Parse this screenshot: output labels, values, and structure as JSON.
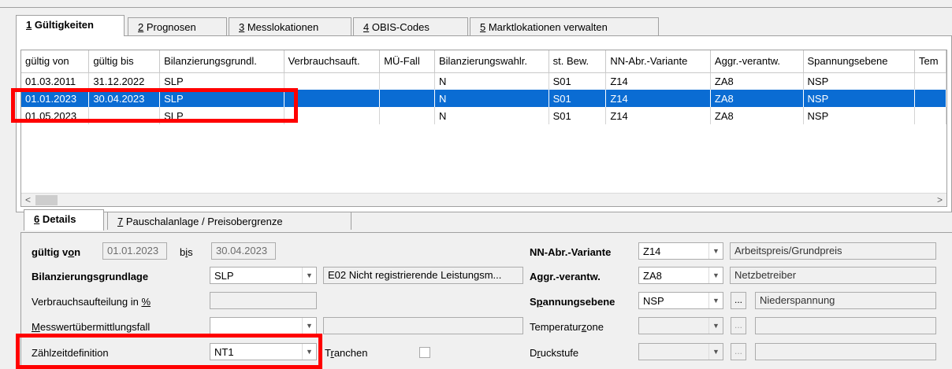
{
  "tabs_top": [
    {
      "key": "1",
      "rest": " Gültigkeiten",
      "active": true
    },
    {
      "key": "2",
      "rest": " Prognosen",
      "active": false
    },
    {
      "key": "3",
      "rest": " Messlokationen",
      "active": false
    },
    {
      "key": "4",
      "rest": " OBIS-Codes",
      "active": false
    },
    {
      "key": "5",
      "rest": " Marktlokationen verwalten",
      "active": false
    }
  ],
  "grid": {
    "columns": [
      "gültig von",
      "gültig bis",
      "Bilanzierungsgrundl.",
      "Verbrauchsauft.",
      "MÜ-Fall",
      "Bilanzierungswahlr.",
      "st. Bew.",
      "NN-Abr.-Variante",
      "Aggr.-verantw.",
      "Spannungsebene",
      "Tem"
    ],
    "rows": [
      [
        "01.03.2011",
        "31.12.2022",
        "SLP",
        "",
        "",
        "N",
        "S01",
        "Z14",
        "ZA8",
        "NSP",
        ""
      ],
      [
        "01.01.2023",
        "30.04.2023",
        "SLP",
        "",
        "",
        "N",
        "S01",
        "Z14",
        "ZA8",
        "NSP",
        ""
      ],
      [
        "01.05.2023",
        "",
        "SLP",
        "",
        "",
        "N",
        "S01",
        "Z14",
        "ZA8",
        "NSP",
        ""
      ]
    ],
    "selected_row": 1
  },
  "scroll": {
    "left_arrow": "<",
    "right_arrow": ">"
  },
  "tabs_bottom": [
    {
      "key": "6",
      "rest": " Details",
      "active": true
    },
    {
      "key": "7",
      "rest": " Pauschalanlage / Preisobergrenze",
      "active": false
    }
  ],
  "details": {
    "gueltig_von_label_a": "gültig v",
    "gueltig_von_label_u": "o",
    "gueltig_von_label_b": "n",
    "gueltig_von_value": "01.01.2023",
    "bis_label_a": "b",
    "bis_label_u": "i",
    "bis_label_b": "s",
    "bis_value": "30.04.2023",
    "bilanz_label_a": "Bilanzierungs",
    "bilanz_label_u": "g",
    "bilanz_label_b": "rundlage",
    "bilanz_value": "SLP",
    "bilanz_desc": "E02 Nicht registrierende Leistungsm...",
    "verbrauch_label_a": "Verbrauchsaufteilung in ",
    "verbrauch_label_u": "%",
    "verbrauch_value": "",
    "mess_label_u": "M",
    "mess_label_b": "esswertübermittlungsfall",
    "mess_value": "",
    "mess_desc": "",
    "zaehl_label_a": "Zählzeitdefinition",
    "zaehl_value": "NT1",
    "tranchen_label_a": "T",
    "tranchen_label_u": "r",
    "tranchen_label_b": "anchen",
    "nn_label": "NN-Abr.-Variante",
    "nn_value": "Z14",
    "nn_desc": "Arbeitspreis/Grundpreis",
    "aggr_label": "Aggr.-verantw.",
    "aggr_value": "ZA8",
    "aggr_desc": "Netzbetreiber",
    "spann_label_a": "S",
    "spann_label_u": "p",
    "spann_label_b": "annungsebene",
    "spann_value": "NSP",
    "spann_desc": "Niederspannung",
    "temp_label_a": "Temperatur",
    "temp_label_u": "z",
    "temp_label_b": "one",
    "temp_value": "",
    "temp_desc": "",
    "druck_label_a": "D",
    "druck_label_u": "r",
    "druck_label_b": "uckstufe",
    "druck_value": "",
    "druck_desc": "",
    "ellipsis": "...",
    "dropdown_arrow": "▼"
  },
  "colors": {
    "selection": "#0a6cd3",
    "highlight": "#ff0000"
  }
}
